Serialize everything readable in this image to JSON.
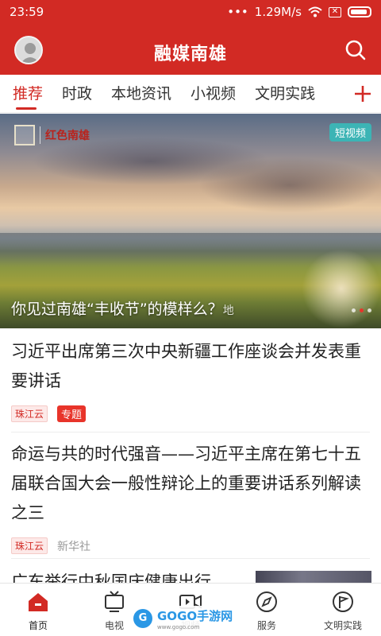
{
  "status_bar": {
    "time": "23:59",
    "speed": "1.29M/s",
    "sim": "✕"
  },
  "header": {
    "title": "融媒南雄"
  },
  "tabs": [
    {
      "label": "推荐",
      "active": true
    },
    {
      "label": "时政",
      "active": false
    },
    {
      "label": "本地资讯",
      "active": false
    },
    {
      "label": "小视频",
      "active": false
    },
    {
      "label": "文明实践",
      "active": false
    }
  ],
  "banner": {
    "logo_text": "红色南雄",
    "badge": "短视频",
    "caption": "你见过南雄“丰收节”的模样么？",
    "caption_suffix": "地",
    "slide_count": 3,
    "active_slide": 2
  },
  "articles": [
    {
      "title": "习近平出席第三次中央新疆工作座谈会并发表重要讲话",
      "source": "珠江云",
      "tag": "专题"
    },
    {
      "title": "命运与共的时代强音——习近平主席在第七十五届联合国大会一般性辩论上的重要讲话系列解读之三",
      "source": "珠江云",
      "publisher": "新华社"
    },
    {
      "title": "广东举行中秋国庆健康出行"
    }
  ],
  "bottom_nav": [
    {
      "label": "首页",
      "icon": "home-icon",
      "active": true
    },
    {
      "label": "电视",
      "icon": "tv-icon",
      "active": false
    },
    {
      "label": "视频",
      "icon": "video-icon",
      "active": false
    },
    {
      "label": "服务",
      "icon": "compass-icon",
      "active": false
    },
    {
      "label": "文明实践",
      "icon": "flag-icon",
      "active": false
    }
  ],
  "watermark": {
    "brand": "GOGO手游网",
    "url": "www.gogo.com"
  },
  "colors": {
    "brand_red": "#d22a24",
    "badge_teal": "#3cb4b5"
  }
}
